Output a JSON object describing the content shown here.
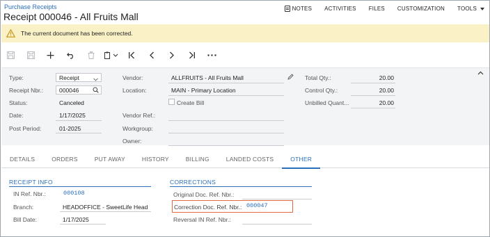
{
  "header": {
    "breadcrumb": "Purchase Receipts",
    "title": "Receipt 000046 - All Fruits Mall",
    "links": [
      "NOTES",
      "ACTIVITIES",
      "FILES",
      "CUSTOMIZATION",
      "TOOLS"
    ]
  },
  "banner": {
    "message": "The current document has been corrected.",
    "color": "#fbf1c7"
  },
  "toolbar": {
    "icons": [
      "save-icon",
      "save-close-icon",
      "add-icon",
      "undo-icon",
      "delete-icon",
      "copy-paste-icon",
      "first-record-icon",
      "previous-record-icon",
      "next-record-icon",
      "last-record-icon",
      "more-icon"
    ]
  },
  "summary": {
    "type_label": "Type:",
    "type_value": "Receipt",
    "receipt_nbr_label": "Receipt Nbr.:",
    "receipt_nbr_value": "000046",
    "status_label": "Status:",
    "status_value": "Canceled",
    "date_label": "Date:",
    "date_value": "1/17/2025",
    "post_period_label": "Post Period:",
    "post_period_value": "01-2025",
    "vendor_label": "Vendor:",
    "vendor_value": "ALLFRUITS - All Fruits Mall",
    "location_label": "Location:",
    "location_value": "MAIN - Primary Location",
    "create_bill_label": "Create Bill",
    "vendor_ref_label": "Vendor Ref.:",
    "workgroup_label": "Workgroup:",
    "owner_label": "Owner:",
    "total_qty_label": "Total Qty.:",
    "total_qty_value": "20.00",
    "control_qty_label": "Control Qty.:",
    "control_qty_value": "20.00",
    "unbilled_qty_label": "Unbilled Quant...",
    "unbilled_qty_value": "20.00"
  },
  "tabs": [
    "DETAILS",
    "ORDERS",
    "PUT AWAY",
    "HISTORY",
    "BILLING",
    "LANDED COSTS",
    "OTHER"
  ],
  "active_tab": "OTHER",
  "receipt_info": {
    "heading": "RECEIPT INFO",
    "in_ref_label": "IN Ref. Nbr.:",
    "in_ref_value": "000108",
    "branch_label": "Branch:",
    "branch_value": "HEADOFFICE - SweetLife Head",
    "bill_date_label": "Bill Date:",
    "bill_date_value": "1/17/2025"
  },
  "corrections": {
    "heading": "CORRECTIONS",
    "original_doc_label": "Original Doc. Ref. Nbr.:",
    "correction_doc_label": "Correction Doc. Ref. Nbr.:",
    "correction_doc_value": "000047",
    "reversal_in_label": "Reversal IN Ref. Nbr.:",
    "highlight_color": "#e06b3e"
  },
  "colors": {
    "accent": "#2a6ebb",
    "summary_bg": "#f3f4f6"
  }
}
